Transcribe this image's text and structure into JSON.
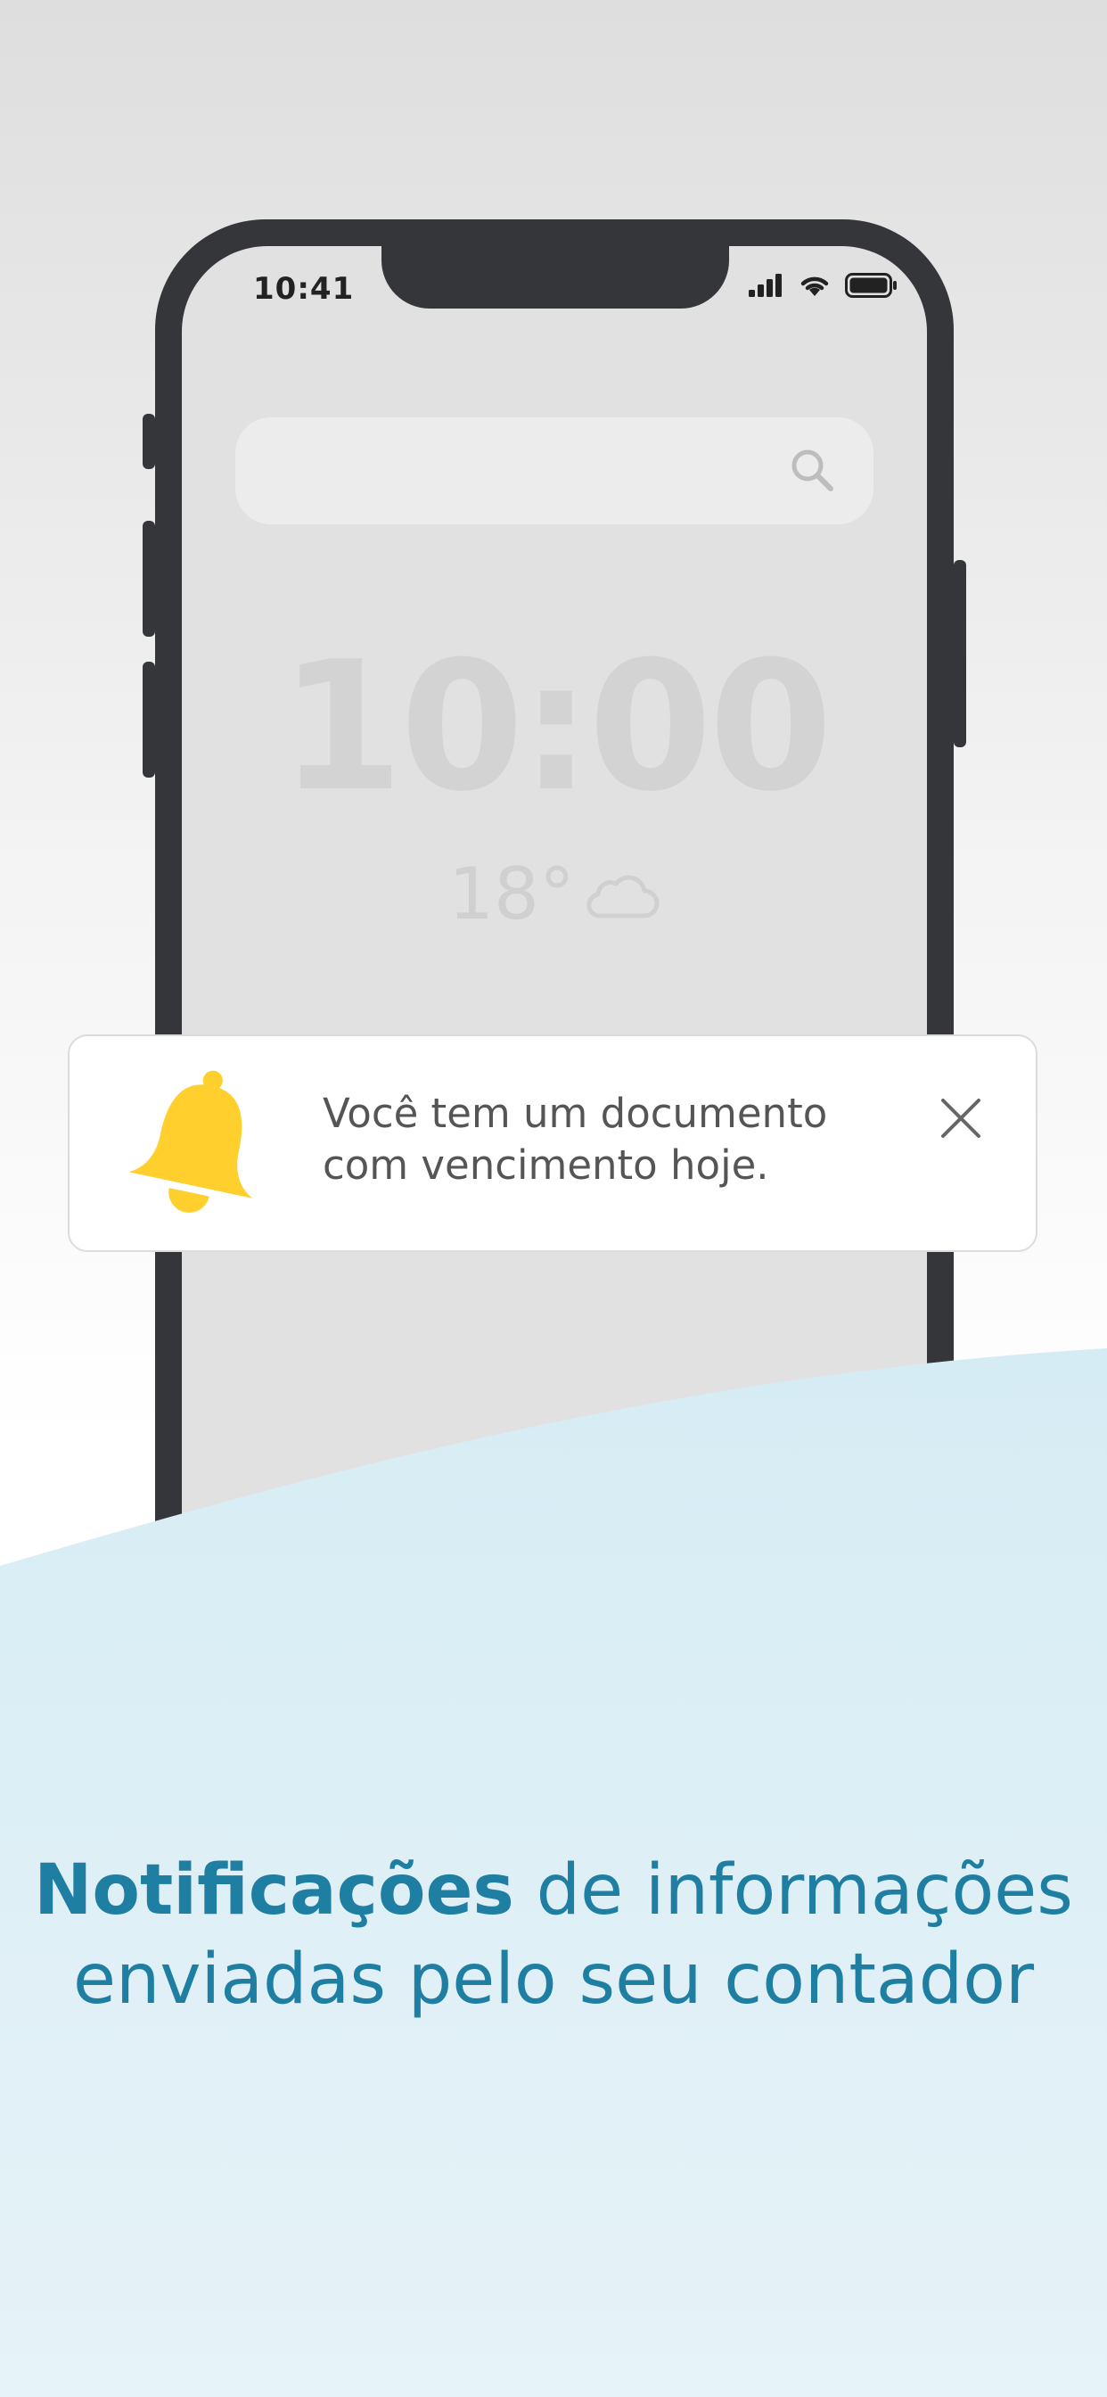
{
  "status_bar": {
    "time": "10:41"
  },
  "lockscreen": {
    "clock": "10:00",
    "temperature": "18°",
    "weather_icon": "cloud-icon"
  },
  "notification": {
    "line1": "Você tem um documento",
    "line2": "com vencimento hoje.",
    "icon": "bell-icon"
  },
  "caption": {
    "bold": "Notificações",
    "rest_line1": " de informações",
    "line2": "enviadas pelo seu contador"
  },
  "colors": {
    "accent": "#1f7fa3",
    "bell": "#ffcf2e",
    "wave": "#d6ecf4"
  }
}
